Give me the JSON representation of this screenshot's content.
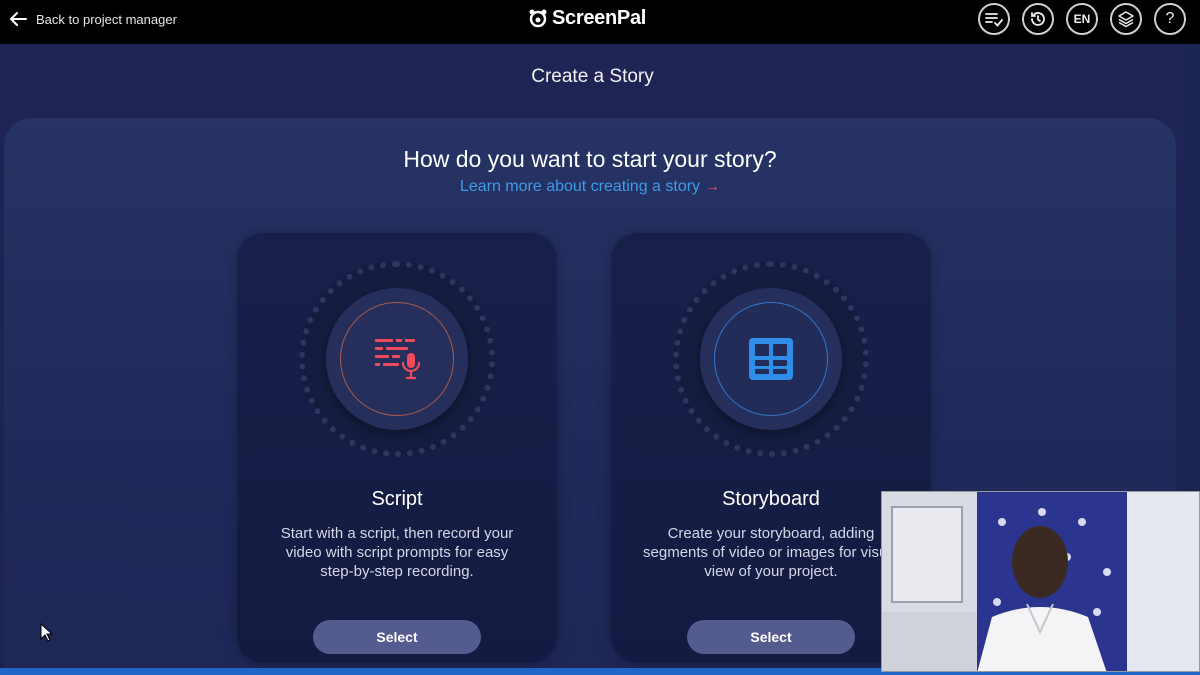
{
  "topbar": {
    "back_label": "Back to project manager",
    "logo_text": "ScreenPal",
    "language": "EN",
    "help": "?"
  },
  "page": {
    "title": "Create a Story",
    "question": "How do you want to start your story?",
    "learn_more": "Learn more about creating a story",
    "learn_more_arrow": "→"
  },
  "cards": [
    {
      "title": "Script",
      "description": "Start with a script, then record your video with script prompts for easy step-by-step recording.",
      "button": "Select",
      "icon": "script-mic-icon"
    },
    {
      "title": "Storyboard",
      "description": "Create your storyboard, adding segments of video or images for visual view of your project.",
      "button": "Select",
      "icon": "storyboard-grid-icon"
    }
  ],
  "colors": {
    "accent_blue": "#3d9be9",
    "accent_red": "#ef4b5c",
    "button_bg": "#545b8e",
    "page_bg": "#1c2450"
  }
}
